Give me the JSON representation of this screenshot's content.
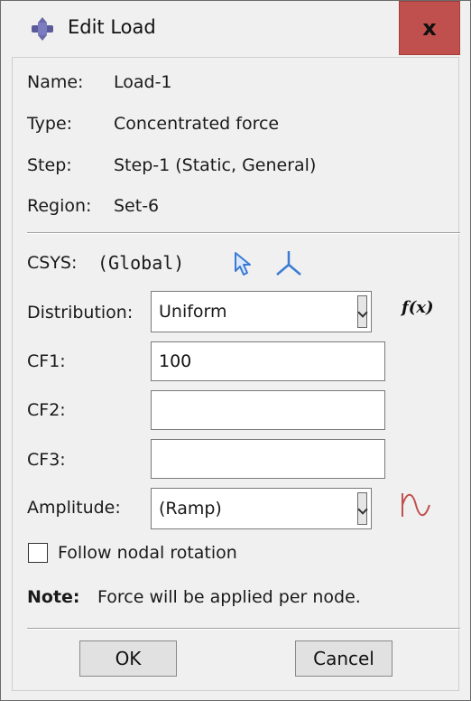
{
  "window": {
    "title": "Edit Load",
    "close_label": "x",
    "icons": {
      "app": "load-icon",
      "close": "close-icon"
    }
  },
  "info": [
    {
      "label": "Name:",
      "value": "Load-1"
    },
    {
      "label": "Type:",
      "value": "Concentrated force"
    },
    {
      "label": "Step:",
      "value": "Step-1 (Static, General)"
    },
    {
      "label": "Region:",
      "value": "Set-6"
    }
  ],
  "csys": {
    "label": "CSYS:",
    "value": "(Global)",
    "icons": {
      "select": "select-arrow-icon",
      "create": "csys-axes-icon"
    }
  },
  "distribution": {
    "label": "Distribution:",
    "value": "Uniform",
    "fx_label": "f(x)"
  },
  "cf1": {
    "label": "CF1:",
    "value": "100"
  },
  "cf2": {
    "label": "CF2:",
    "value": ""
  },
  "cf3": {
    "label": "CF3:",
    "value": ""
  },
  "amplitude": {
    "label": "Amplitude:",
    "value": "(Ramp)",
    "icon": "amplitude-wave-icon"
  },
  "follow_rotation": {
    "label": "Follow nodal rotation",
    "checked": false
  },
  "note": {
    "label": "Note:",
    "text": "Force will be applied per node."
  },
  "buttons": {
    "ok": "OK",
    "cancel": "Cancel"
  },
  "colors": {
    "close_bg": "#c0504d",
    "select_icon": "#3a7bd5",
    "amp_icon": "#c0504d"
  }
}
